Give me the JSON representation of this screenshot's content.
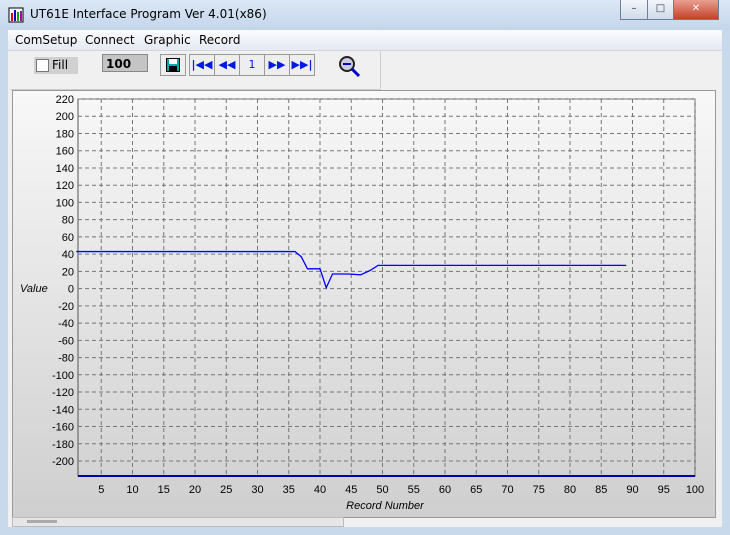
{
  "window": {
    "title": "UT61E Interface Program Ver 4.01(x86)"
  },
  "menu": [
    {
      "label": "ComSetup"
    },
    {
      "label": "Connect"
    },
    {
      "label": "Graphic"
    },
    {
      "label": "Record"
    }
  ],
  "toolbar": {
    "fill_label": "Fill",
    "fill_checked": false,
    "record_count": "100",
    "page": "1",
    "icons": [
      "save-icon",
      "first-icon",
      "prev-icon",
      "next-icon",
      "last-icon",
      "zoom-out-icon"
    ]
  },
  "chart_data": {
    "type": "line",
    "xlabel": "Record Number",
    "ylabel": "Value",
    "xlim": [
      1,
      100
    ],
    "ylim": [
      -200,
      220
    ],
    "grid": true,
    "xticks": [
      5,
      10,
      15,
      20,
      25,
      30,
      35,
      40,
      45,
      50,
      55,
      60,
      65,
      70,
      75,
      80,
      85,
      90,
      95,
      100
    ],
    "yticks": [
      220,
      200,
      180,
      160,
      140,
      120,
      100,
      80,
      60,
      40,
      20,
      0,
      -20,
      -40,
      -60,
      -80,
      -100,
      -120,
      -140,
      -160,
      -180,
      -200
    ],
    "line_color": "#0000ff",
    "x": [
      1,
      36,
      37,
      38,
      40,
      41,
      42,
      44.5,
      46.5,
      48,
      49.3,
      89
    ],
    "y": [
      43,
      43,
      37,
      23,
      23,
      1,
      17,
      17,
      16,
      21,
      27,
      27
    ]
  }
}
